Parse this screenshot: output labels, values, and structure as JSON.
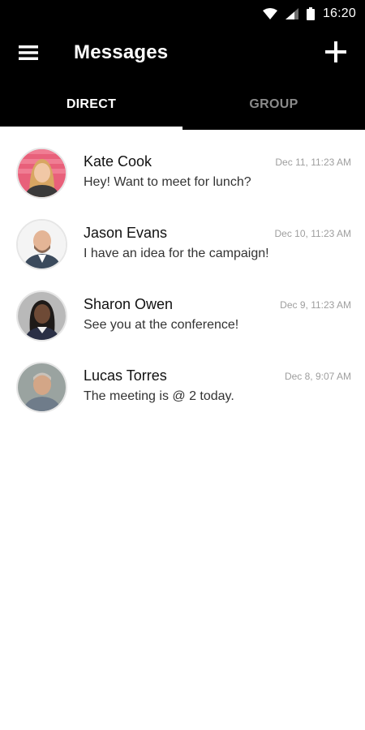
{
  "status_bar": {
    "time": "16:20",
    "icons": [
      "wifi-icon",
      "cellular-signal-icon",
      "battery-icon"
    ]
  },
  "app_bar": {
    "title": "Messages",
    "menu_icon": "hamburger-menu-icon",
    "add_icon": "plus-icon"
  },
  "tabs": [
    {
      "label": "DIRECT",
      "active": true
    },
    {
      "label": "GROUP",
      "active": false
    }
  ],
  "conversations": [
    {
      "name": "Kate Cook",
      "message": "Hey! Want to meet for lunch?",
      "time": "Dec 11, 11:23 AM",
      "avatar": "kate-cook-avatar"
    },
    {
      "name": "Jason Evans",
      "message": "I have an idea for the campaign!",
      "time": "Dec 10, 11:23 AM",
      "avatar": "jason-evans-avatar"
    },
    {
      "name": "Sharon Owen",
      "message": "See you at the conference!",
      "time": "Dec 9, 11:23 AM",
      "avatar": "sharon-owen-avatar"
    },
    {
      "name": "Lucas Torres",
      "message": "The meeting is @ 2 today.",
      "time": "Dec 8, 9:07 AM",
      "avatar": "lucas-torres-avatar"
    }
  ],
  "colors": {
    "app_bar_bg": "#000000",
    "tab_active": "#ffffff",
    "tab_inactive": "#8a8a8a",
    "timestamp": "#9e9e9e"
  }
}
